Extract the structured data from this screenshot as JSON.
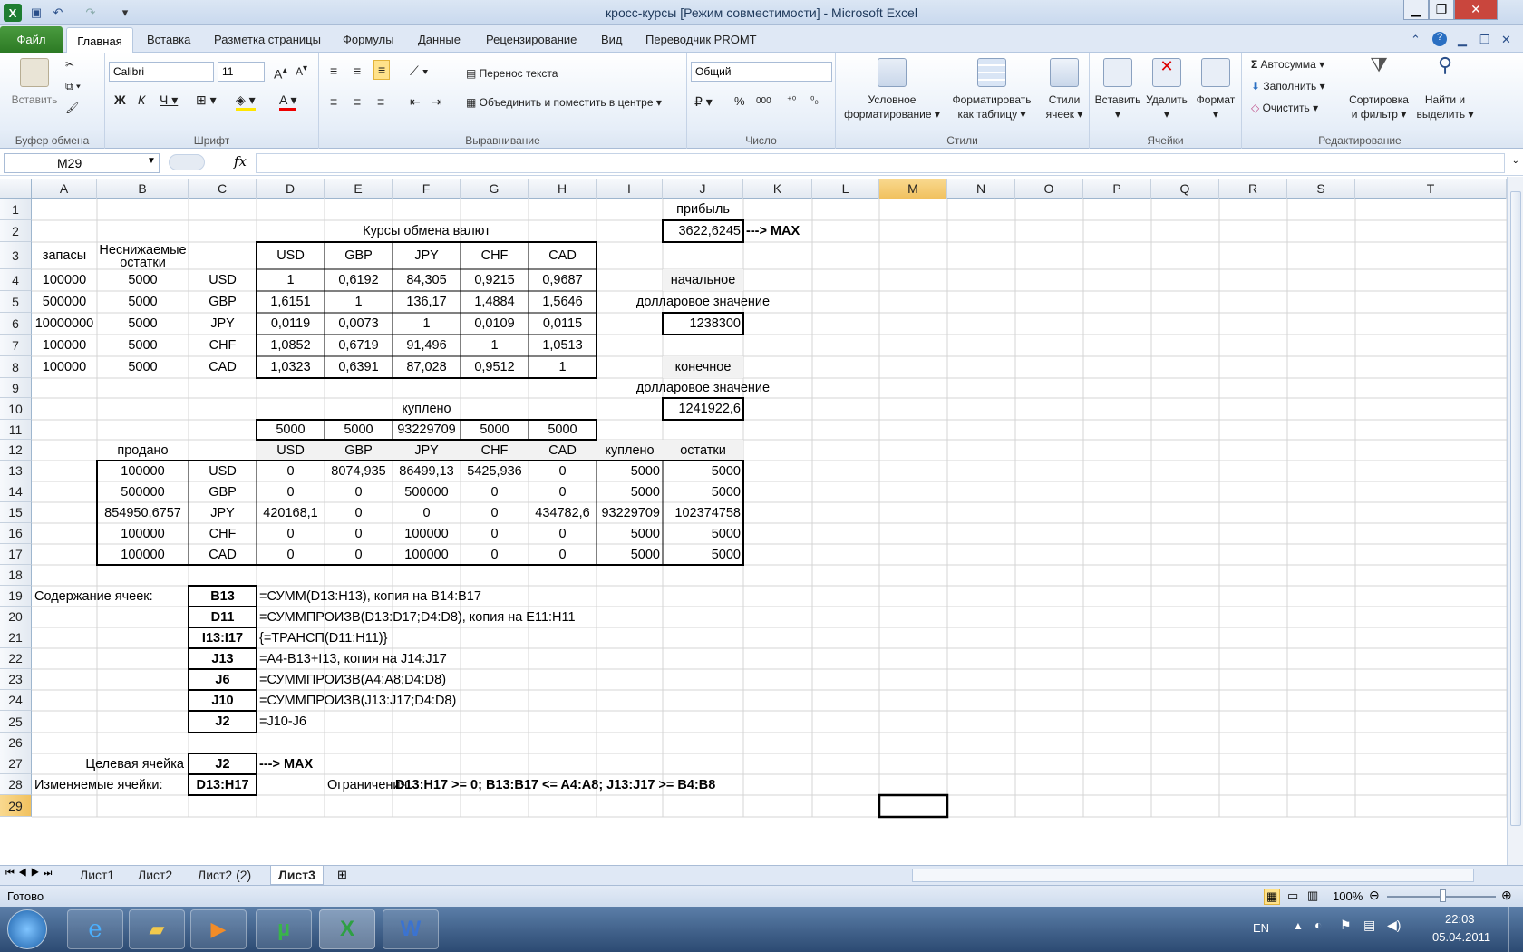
{
  "app": {
    "title": "кросс-курсы  [Режим совместимости] - Microsoft Excel"
  },
  "tabs": {
    "file": "Файл",
    "home": "Главная",
    "items": [
      "Вставка",
      "Разметка страницы",
      "Формулы",
      "Данные",
      "Рецензирование",
      "Вид",
      "Переводчик PROMT"
    ]
  },
  "ribbon": {
    "clipboard": {
      "paste": "Вставить",
      "label": "Буфер обмена"
    },
    "font": {
      "name": "Calibri",
      "size": "11",
      "label": "Шрифт"
    },
    "align": {
      "wrap": "Перенос текста",
      "merge": "Объединить и поместить в центре",
      "label": "Выравнивание"
    },
    "number": {
      "format": "Общий",
      "percent": "%",
      "thousands": "000",
      "label": "Число"
    },
    "styles": {
      "cond": "Условное",
      "cond2": "форматирование",
      "table": "Форматировать",
      "table2": "как таблицу",
      "cell": "Стили",
      "cell2": "ячеек",
      "label": "Стили"
    },
    "cells": {
      "insert": "Вставить",
      "delete": "Удалить",
      "format": "Формат",
      "label": "Ячейки"
    },
    "edit": {
      "autosum": "Автосумма",
      "fill": "Заполнить",
      "clear": "Очистить",
      "sort": "Сортировка",
      "sort2": "и фильтр",
      "find": "Найти и",
      "find2": "выделить",
      "label": "Редактирование"
    }
  },
  "formula": {
    "namebox": "M29",
    "fx": "fx",
    "value": ""
  },
  "columns": [
    "A",
    "B",
    "C",
    "D",
    "E",
    "F",
    "G",
    "H",
    "I",
    "J",
    "K",
    "L",
    "M",
    "N",
    "O",
    "P",
    "Q",
    "R",
    "S",
    "T"
  ],
  "rows": [
    "1",
    "2",
    "3",
    "4",
    "5",
    "6",
    "7",
    "8",
    "9",
    "10",
    "11",
    "12",
    "13",
    "14",
    "15",
    "16",
    "17",
    "18",
    "19",
    "20",
    "21",
    "22",
    "23",
    "24",
    "25",
    "26",
    "27",
    "28",
    "29"
  ],
  "cells": {
    "J1": "прибыль",
    "F2": "Курсы обмена валют",
    "J2": "3622,6245",
    "K2": "---> MAX",
    "A3": "запасы",
    "B3a": "Неснижаемые",
    "B3b": "остатки",
    "D3": "USD",
    "E3": "GBP",
    "F3": "JPY",
    "G3": "CHF",
    "H3": "CAD",
    "A4": "100000",
    "B4": "5000",
    "C4": "USD",
    "D4": "1",
    "E4": "0,6192",
    "F4": "84,305",
    "G4": "0,9215",
    "H4": "0,9687",
    "J4": "начальное",
    "A5": "500000",
    "B5": "5000",
    "C5": "GBP",
    "D5": "1,6151",
    "E5": "1",
    "F5": "136,17",
    "G5": "1,4884",
    "H5": "1,5646",
    "J5": "долларовое значение",
    "A6": "10000000",
    "B6": "5000",
    "C6": "JPY",
    "D6": "0,0119",
    "E6": "0,0073",
    "F6": "1",
    "G6": "0,0109",
    "H6": "0,0115",
    "J6": "1238300",
    "A7": "100000",
    "B7": "5000",
    "C7": "CHF",
    "D7": "1,0852",
    "E7": "0,6719",
    "F7": "91,496",
    "G7": "1",
    "H7": "1,0513",
    "A8": "100000",
    "B8": "5000",
    "C8": "CAD",
    "D8": "1,0323",
    "E8": "0,6391",
    "F8": "87,028",
    "G8": "0,9512",
    "H8": "1",
    "J8": "конечное",
    "J9": "долларовое значение",
    "F10": "куплено",
    "J10": "1241922,6",
    "D11": "5000",
    "E11": "5000",
    "F11": "93229709",
    "G11": "5000",
    "H11": "5000",
    "B12": "продано",
    "D12": "USD",
    "E12": "GBP",
    "F12": "JPY",
    "G12": "CHF",
    "H12": "CAD",
    "I12": "куплено",
    "J12": "остатки",
    "B13": "100000",
    "C13": "USD",
    "D13": "0",
    "E13": "8074,935",
    "F13": "86499,13",
    "G13": "5425,936",
    "H13": "0",
    "I13": "5000",
    "J13": "5000",
    "B14": "500000",
    "C14": "GBP",
    "D14": "0",
    "E14": "0",
    "F14": "500000",
    "G14": "0",
    "H14": "0",
    "I14": "5000",
    "J14": "5000",
    "B15": "854950,6757",
    "C15": "JPY",
    "D15": "420168,1",
    "E15": "0",
    "F15": "0",
    "G15": "0",
    "H15": "434782,6",
    "I15": "93229709",
    "J15": "102374758",
    "B16": "100000",
    "C16": "CHF",
    "D16": "0",
    "E16": "0",
    "F16": "100000",
    "G16": "0",
    "H16": "0",
    "I16": "5000",
    "J16": "5000",
    "B17": "100000",
    "C17": "CAD",
    "D17": "0",
    "E17": "0",
    "F17": "100000",
    "G17": "0",
    "H17": "0",
    "I17": "5000",
    "J17": "5000",
    "A19": "Содержание ячеек:",
    "C19": "B13",
    "D19": "=СУММ(D13:H13), копия на B14:B17",
    "C20": "D11",
    "D20": "=СУММПРОИЗВ(D13:D17;D4:D8), копия на E11:H11",
    "C21": "I13:I17",
    "D21": "{=ТРАНСП(D11:H11)}",
    "C22": "J13",
    "D22": "=A4-B13+I13, копия на J14:J17",
    "C23": "J6",
    "D23": "=СУММПРОИЗВ(A4:A8;D4:D8)",
    "C24": "J10",
    "D24": "=СУММПРОИЗВ(J13:J17;D4:D8)",
    "C25": "J2",
    "D25": "=J10-J6",
    "B27": "Целевая ячейка",
    "C27": "J2",
    "D27": "---> MAX",
    "A28": "Изменяемые ячейки:",
    "C28": "D13:H17",
    "E28": "Ограничения:",
    "F28": "D13:H17 >= 0;   B13:B17 <= A4:A8;   J13:J17 >= B4:B8"
  },
  "sheets": [
    "Лист1",
    "Лист2",
    "Лист2 (2)",
    "Лист3"
  ],
  "status": {
    "ready": "Готово",
    "zoom": "100%"
  },
  "taskbar": {
    "lang": "EN",
    "time": "22:03",
    "date": "05.04.2011"
  }
}
